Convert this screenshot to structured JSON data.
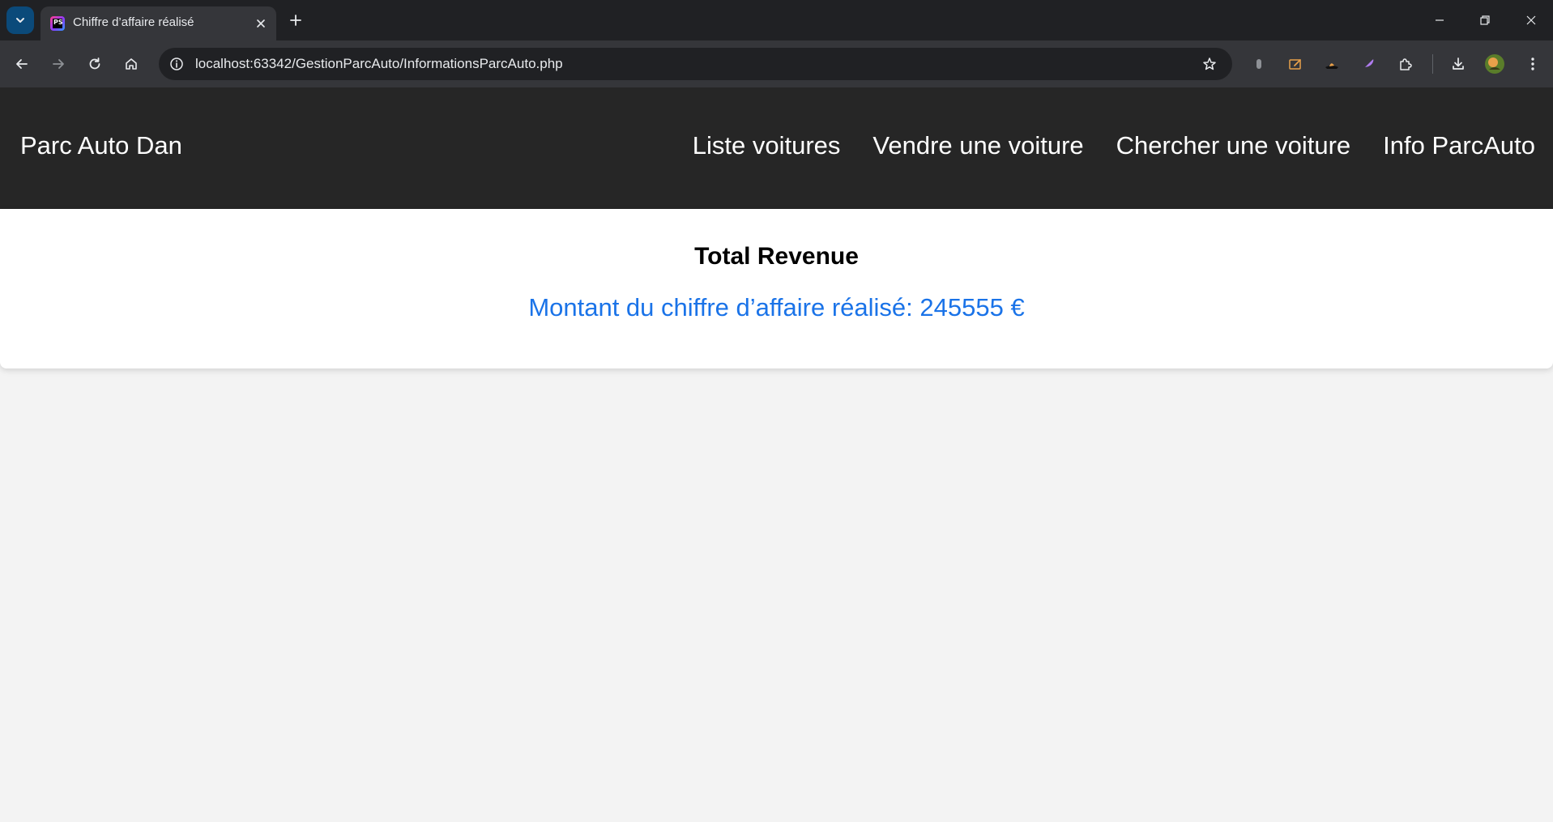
{
  "browser": {
    "tab_title": "Chiffre d’affaire réalisé",
    "favicon_text": "PS",
    "url": "localhost:63342/GestionParcAuto/InformationsParcAuto.php"
  },
  "site": {
    "brand": "Parc Auto Dan",
    "nav": [
      "Liste voitures",
      "Vendre une voiture",
      "Chercher une voiture",
      "Info ParcAuto"
    ]
  },
  "revenue": {
    "title": "Total Revenue",
    "amount_text": "Montant du chiffre d’affaire réalisé: 245555 €"
  },
  "colors": {
    "header_bg": "#262626",
    "page_bg": "#f3f3f3",
    "amount_color": "#1a73e8"
  }
}
